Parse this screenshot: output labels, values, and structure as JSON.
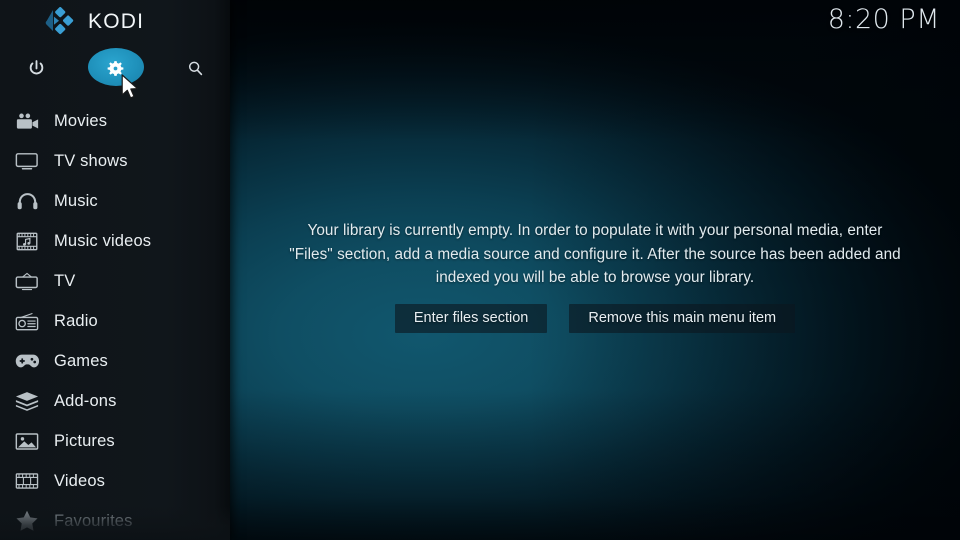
{
  "app": {
    "brand_name": "KODI",
    "logo_icon": "kodi-logo-icon"
  },
  "clock": {
    "time": "8:20 PM"
  },
  "colors": {
    "accent": "#1f91bb",
    "accent_light": "#2ba5cf",
    "sidebar_bg": "#10161b",
    "content_center": "#11576e",
    "content_edge": "#01090e",
    "text_primary": "#e9eef1",
    "text_dim": "#8e979d",
    "button_bg": "#0b161e"
  },
  "sidebar": {
    "top_buttons": [
      {
        "name": "power",
        "label": "Power",
        "icon": "power-icon",
        "active": false
      },
      {
        "name": "settings",
        "label": "Settings",
        "icon": "gear-icon",
        "active": true
      },
      {
        "name": "search",
        "label": "Search",
        "icon": "search-icon",
        "active": false
      }
    ],
    "items": [
      {
        "label": "Movies",
        "icon": "movie-camera-icon",
        "dim": false
      },
      {
        "label": "TV shows",
        "icon": "tv-icon",
        "dim": false
      },
      {
        "label": "Music",
        "icon": "headphones-icon",
        "dim": false
      },
      {
        "label": "Music videos",
        "icon": "music-video-icon",
        "dim": false
      },
      {
        "label": "TV",
        "icon": "tv-antenna-icon",
        "dim": false
      },
      {
        "label": "Radio",
        "icon": "radio-icon",
        "dim": false
      },
      {
        "label": "Games",
        "icon": "gamepad-icon",
        "dim": false
      },
      {
        "label": "Add-ons",
        "icon": "addons-box-icon",
        "dim": false
      },
      {
        "label": "Pictures",
        "icon": "picture-icon",
        "dim": false
      },
      {
        "label": "Videos",
        "icon": "film-strip-icon",
        "dim": false
      },
      {
        "label": "Favourites",
        "icon": "star-icon",
        "dim": true
      }
    ]
  },
  "main": {
    "empty_message": "Your library is currently empty. In order to populate it with your personal media, enter \"Files\" section, add a media source and configure it. After the source has been added and indexed you will be able to browse your library.",
    "buttons": [
      {
        "label": "Enter files section"
      },
      {
        "label": "Remove this main menu item"
      }
    ]
  },
  "cursor": {
    "icon": "mouse-pointer-icon"
  }
}
